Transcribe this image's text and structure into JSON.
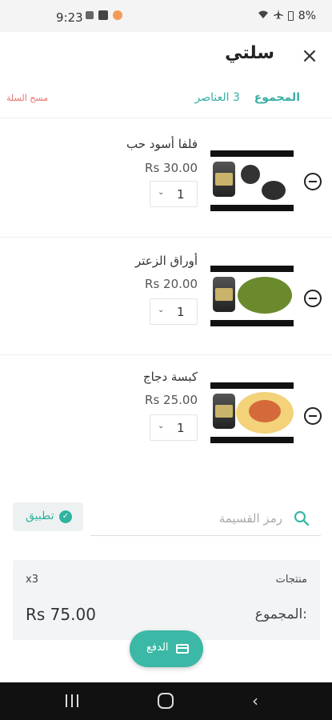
{
  "status_bar": {
    "time": "9:23",
    "battery": "8%"
  },
  "header": {
    "title": "سلتي",
    "close_icon": "close-icon"
  },
  "summary": {
    "total_label": "المجموع",
    "items_count": "3 العناصر",
    "clear_label": "مسح السلة"
  },
  "items": [
    {
      "name": "فلفا أسود حب",
      "price": "Rs 30.00",
      "qty": "1"
    },
    {
      "name": "أوراق الزعتر",
      "price": "Rs 20.00",
      "qty": "1"
    },
    {
      "name": "كبسة دجاج",
      "price": "Rs 25.00",
      "qty": "1"
    }
  ],
  "coupon": {
    "placeholder": "رمز القسيمة",
    "apply_label": "تطبيق"
  },
  "totals": {
    "products_label": "منتجات",
    "products_count": "x3",
    "total_label": "المجموع:",
    "total_value": "Rs 75.00"
  },
  "checkout": {
    "pay_label": "الدفع"
  },
  "colors": {
    "accent": "#3bb8a6",
    "danger": "#e8716f"
  }
}
